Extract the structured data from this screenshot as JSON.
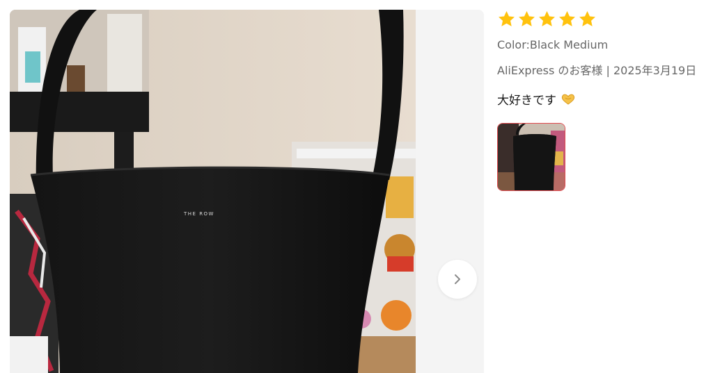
{
  "review": {
    "rating": 5,
    "color_label": "Color:Black Medium",
    "author_date": "AliExpress のお客様 | 2025年3月19日",
    "text": "大好きです",
    "text_emoji": "heart-hands-emoji"
  },
  "photo": {
    "brand_mark": "THE ROW",
    "description_icon": "black-leather-bucket-bag-photo"
  },
  "colors": {
    "star": "#ffc20e",
    "thumb_border": "#e0474c",
    "viewer_bg": "#f4f4f4",
    "meta_text": "#666666"
  },
  "icons": {
    "next": "chevron-right-icon",
    "star": "star-icon"
  }
}
